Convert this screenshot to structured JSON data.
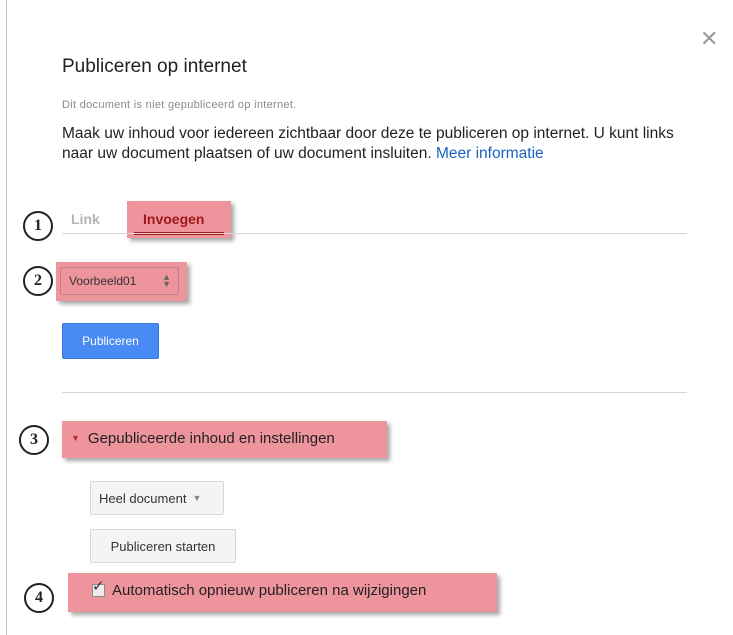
{
  "dialog": {
    "title": "Publiceren op internet",
    "status": "Dit document is niet gepubliceerd op internet.",
    "description": "Maak uw inhoud voor iedereen zichtbaar door deze te publiceren op internet. U kunt links naar uw document plaatsen of uw document insluiten.",
    "more_info_link": "Meer informatie",
    "close_icon": "close-icon"
  },
  "tabs": [
    {
      "label": "Link",
      "selected": false
    },
    {
      "label": "Invoegen",
      "selected": true
    }
  ],
  "size_select": {
    "value": "Voorbeeld01"
  },
  "publish_button": "Publiceren",
  "published_section": {
    "label": "Gepubliceerde inhoud en instellingen",
    "expanded": true,
    "scope_select": "Heel document",
    "start_button": "Publiceren starten",
    "auto_republish": {
      "label": "Automatisch opnieuw publiceren na wijzigingen",
      "checked": true
    }
  },
  "callouts": [
    "1",
    "2",
    "3",
    "4"
  ],
  "colors": {
    "highlight": "#ee949c",
    "primary_button": "#4a8af4",
    "link": "#1a62c1",
    "active_tab": "#a01818"
  }
}
